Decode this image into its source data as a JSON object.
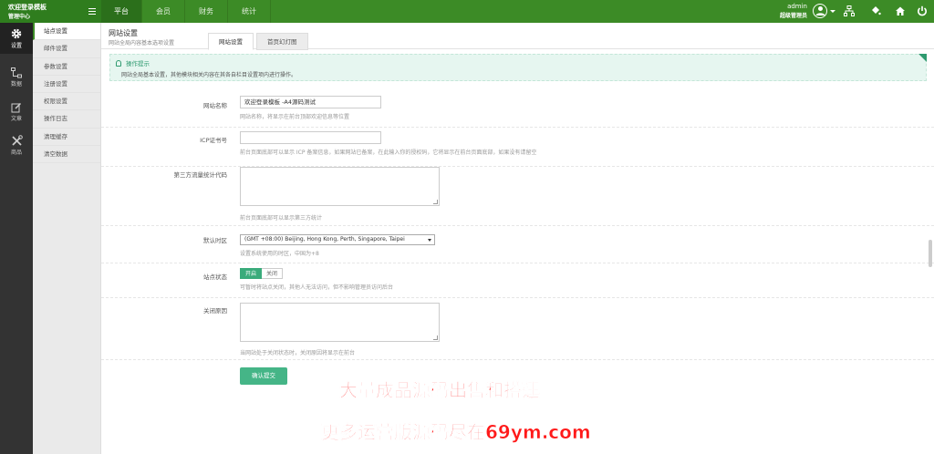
{
  "brand": {
    "title": "欢迎登录模板",
    "subtitle": "管理中心"
  },
  "nav": {
    "tabs": [
      "平台",
      "会员",
      "财务",
      "统计"
    ]
  },
  "user": {
    "name": "admin",
    "role": "超级管理员"
  },
  "iconbar": {
    "items": [
      "设置",
      "数据",
      "文章",
      "商品"
    ]
  },
  "submenu": {
    "items": [
      "站点设置",
      "邮件设置",
      "参数设置",
      "注册设置",
      "权限设置",
      "操作日志",
      "清理缓存",
      "清空数据"
    ]
  },
  "page": {
    "title": "网站设置",
    "subtitle": "网站全局内容基本选项设置",
    "tabs": [
      "网站设置",
      "首页幻灯图"
    ]
  },
  "tip": {
    "title": "操作提示",
    "text": "网站全局基本设置，其他模块相关内容在其各自栏目设置项内进行操作。"
  },
  "form": {
    "site_name": {
      "label": "网站名称",
      "value": "欢迎登录模板 -A4源码测试",
      "hint": "网站名称，将显示在前台顶部欢迎信息等位置"
    },
    "icp": {
      "label": "ICP证书号",
      "value": "",
      "hint": "前台页面底部可以显示 ICP 备案信息，如果网站已备案，在此输入你的授权码，它将显示在前台页面底部，如果没有请留空"
    },
    "stats": {
      "label": "第三方流量统计代码",
      "hint": "前台页面底部可以显示第三方统计"
    },
    "timezone": {
      "label": "默认时区",
      "value": "(GMT +08:00) Beijing, Hong Kong, Perth, Singapore, Taipei",
      "hint": "设置系统使用的时区，中国为+8"
    },
    "status": {
      "label": "站点状态",
      "on": "开启",
      "off": "关闭",
      "hint": "可暂时将站点关闭，其他人无法访问，但不影响管理员访问后台"
    },
    "close_reason": {
      "label": "关闭原因",
      "hint": "当网站处于关闭状态时，关闭原因将显示在前台"
    },
    "submit": "确认提交"
  },
  "watermark": {
    "line1": "大量成品源码出售和搭建",
    "line2": "更多运营版源码尽在69ym.com"
  },
  "colors": {
    "topbar": "#3c8b26",
    "accent": "#45b587",
    "sidebar": "#333333"
  }
}
